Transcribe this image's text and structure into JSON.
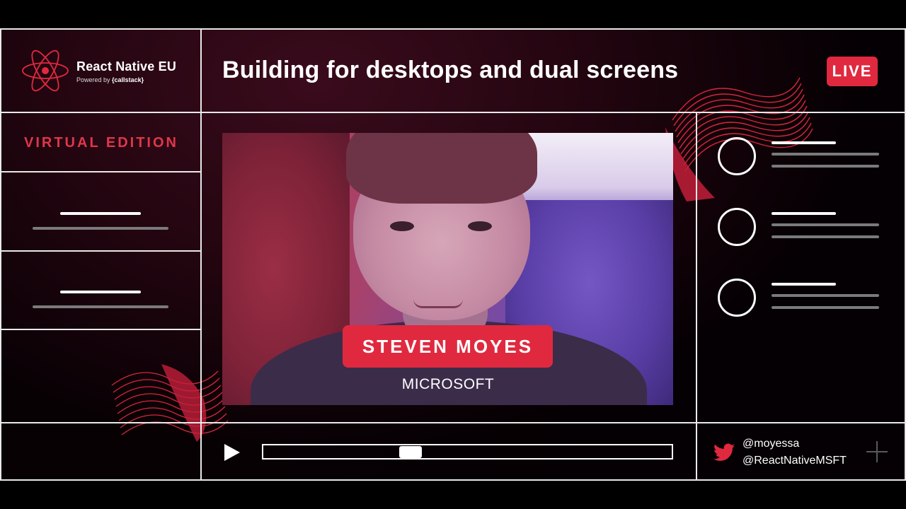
{
  "logo": {
    "name": "React Native EU",
    "powered_by": "Powered by",
    "sponsor": "{callstack}"
  },
  "header": {
    "title": "Building for desktops and dual screens",
    "live_label": "LIVE"
  },
  "sidebar": {
    "edition": "VIRTUAL EDITION"
  },
  "speaker": {
    "name": "STEVEN MOYES",
    "company": "MICROSOFT"
  },
  "player": {
    "progress": 0.36
  },
  "social": {
    "handle_1": "@moyessa",
    "handle_2": "@ReactNativeMSFT"
  },
  "colors": {
    "accent": "#e0293f",
    "frame_line": "#e9e9e9"
  },
  "icons": {
    "logo": "react-atom-icon",
    "play": "play-icon",
    "twitter": "twitter-icon",
    "plus": "plus-icon"
  }
}
